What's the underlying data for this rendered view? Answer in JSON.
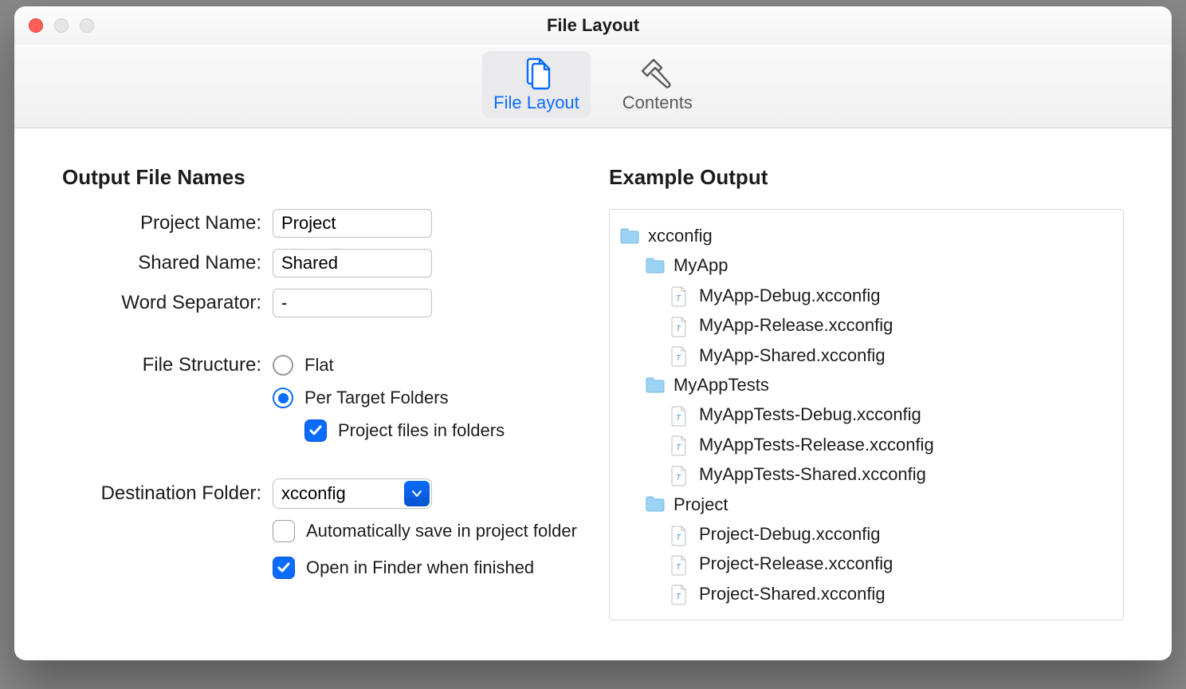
{
  "window": {
    "title": "File Layout"
  },
  "tabs": {
    "file_layout": "File Layout",
    "contents": "Contents"
  },
  "left": {
    "heading": "Output File Names",
    "project_name_label": "Project Name:",
    "project_name_value": "Project",
    "shared_name_label": "Shared Name:",
    "shared_name_value": "Shared",
    "word_sep_label": "Word Separator:",
    "word_sep_value": "-",
    "file_structure_label": "File Structure:",
    "structure_flat": "Flat",
    "structure_per_target": "Per Target Folders",
    "structure_project_in_folders": "Project files in folders",
    "dest_folder_label": "Destination Folder:",
    "dest_folder_value": "xcconfig",
    "auto_save_label": "Automatically save in project folder",
    "open_finder_label": "Open in Finder when finished"
  },
  "right": {
    "heading": "Example Output",
    "tree": {
      "root": "xcconfig",
      "myapp": {
        "name": "MyApp",
        "files": [
          "MyApp-Debug.xcconfig",
          "MyApp-Release.xcconfig",
          "MyApp-Shared.xcconfig"
        ]
      },
      "myapptests": {
        "name": "MyAppTests",
        "files": [
          "MyAppTests-Debug.xcconfig",
          "MyAppTests-Release.xcconfig",
          "MyAppTests-Shared.xcconfig"
        ]
      },
      "project": {
        "name": "Project",
        "files": [
          "Project-Debug.xcconfig",
          "Project-Release.xcconfig",
          "Project-Shared.xcconfig"
        ]
      }
    }
  }
}
